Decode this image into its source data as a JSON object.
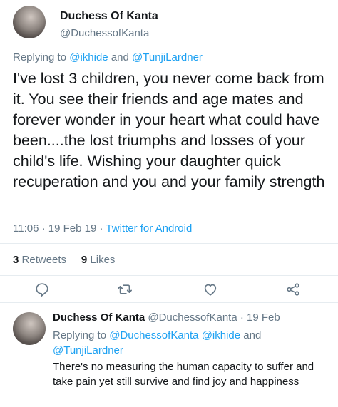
{
  "main_tweet": {
    "author_name": "Duchess Of Kanta",
    "author_handle": "@DuchessofKanta",
    "replying_prefix": "Replying to",
    "replying_to": [
      "@ikhide",
      "@TunjiLardner"
    ],
    "replying_and": "and",
    "body": "I've lost 3 children, you never come back from it. You see their friends and age mates and forever wonder in your heart what could have been....the lost triumphs and losses of your child's life. Wishing your daughter quick recuperation and you and your family strength",
    "time": "11:06",
    "date": "19 Feb 19",
    "source": "Twitter for Android",
    "retweets_count": "3",
    "retweets_label": "Retweets",
    "likes_count": "9",
    "likes_label": "Likes"
  },
  "actions": {
    "reply_icon": "reply-icon",
    "retweet_icon": "retweet-icon",
    "like_icon": "like-icon",
    "share_icon": "share-icon"
  },
  "reply_tweet": {
    "author_name": "Duchess Of Kanta",
    "author_handle": "@DuchessofKanta",
    "date": "19 Feb",
    "replying_prefix": "Replying to",
    "replying_to": [
      "@DuchessofKanta",
      "@ikhide",
      "@TunjiLardner"
    ],
    "replying_and": "and",
    "body": "There's no measuring the human capacity to suffer and take pain yet still survive and find joy and happiness"
  },
  "colors": {
    "accent": "#1da1f2",
    "muted": "#657786",
    "text": "#14171a",
    "divider": "#e6ecf0"
  }
}
